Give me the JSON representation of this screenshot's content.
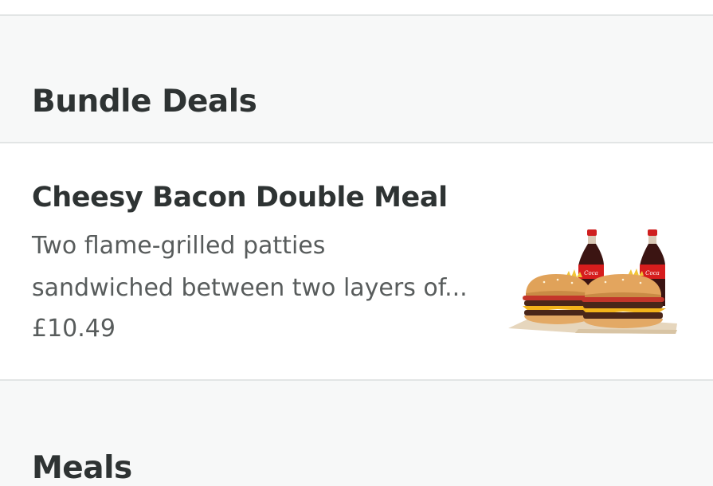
{
  "sections": [
    {
      "heading": "Bundle Deals"
    },
    {
      "heading": "Meals"
    }
  ],
  "items": [
    {
      "title": "Cheesy Bacon Double Meal",
      "description_line1": "Two flame-grilled patties",
      "description_line2": "sandwiched between two layers of...",
      "price": "£10.49",
      "image": "two-burgers-and-cola-bottles-photo"
    }
  ],
  "colors": {
    "page_background": "#f7f8f8",
    "card_background": "#ffffff",
    "divider": "#e2e5e5",
    "heading_text": "#2e3333",
    "secondary_text": "#585c5c"
  }
}
